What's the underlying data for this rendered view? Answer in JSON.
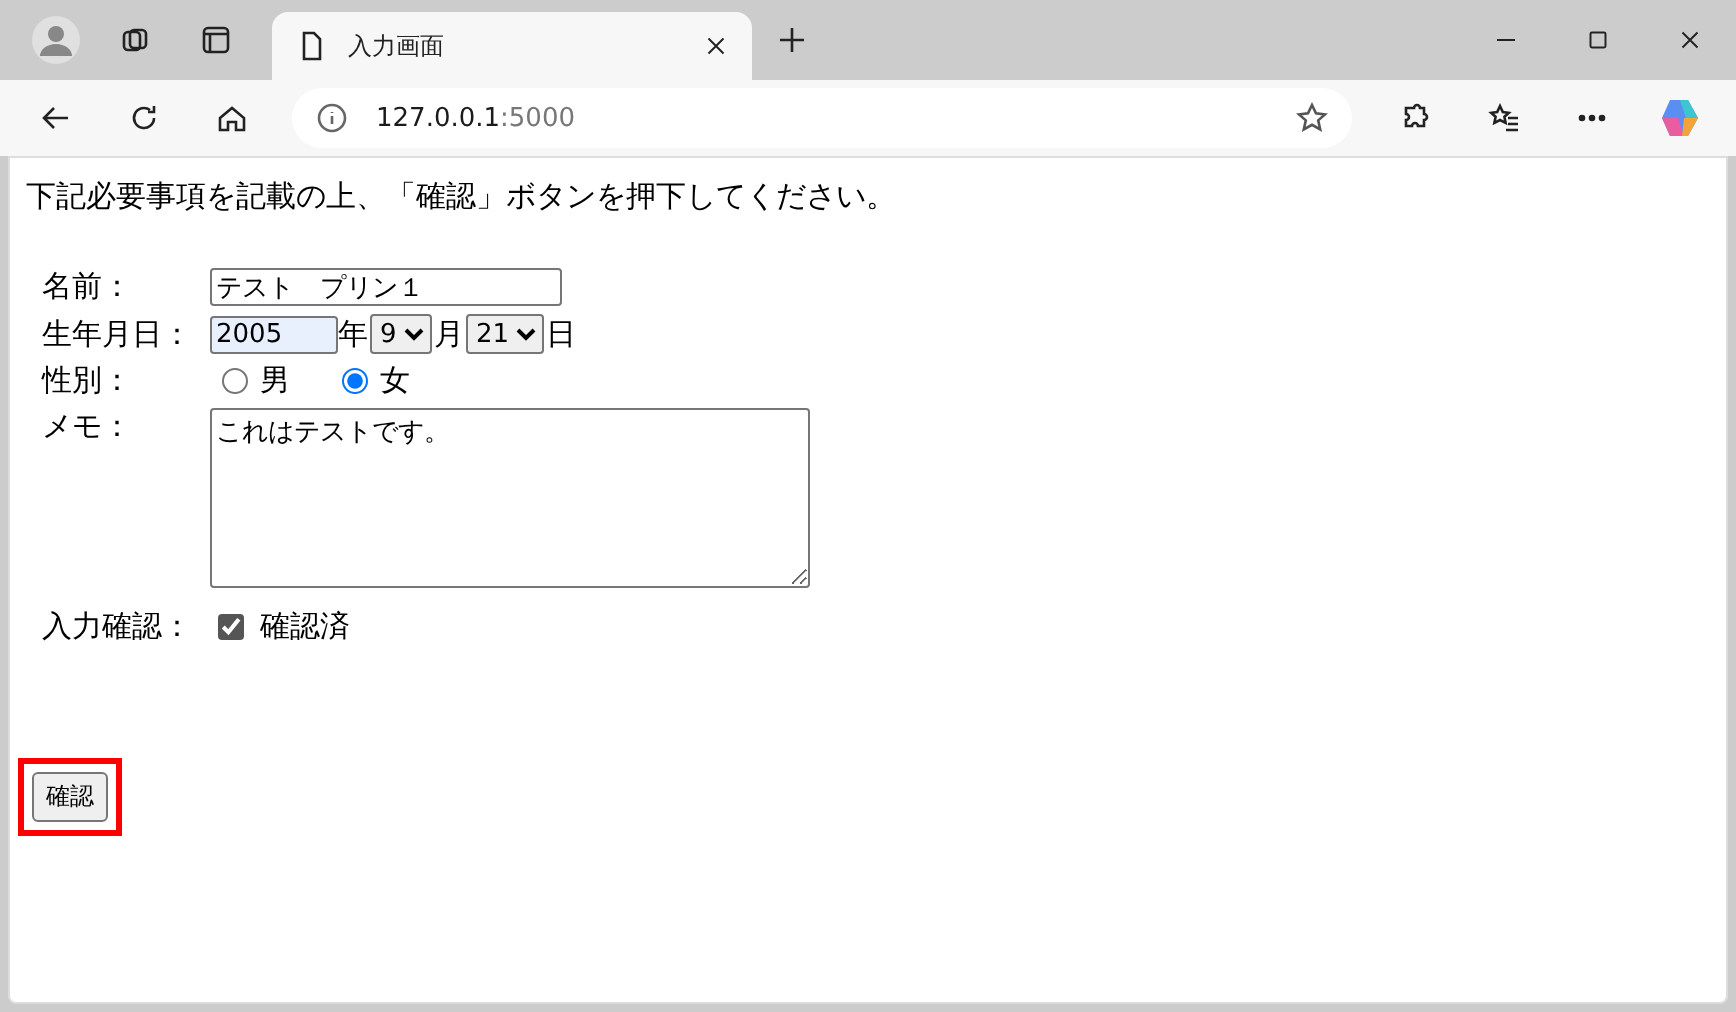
{
  "browser": {
    "tab": {
      "title": "入力画面",
      "selected": true
    },
    "address": {
      "host": "127.0.0.1",
      "port": ":5000"
    }
  },
  "page": {
    "instruction": "下記必要事項を記載の上、「確認」ボタンを押下してください。",
    "name": {
      "label": "名前：",
      "value": "テスト　プリン１"
    },
    "birth": {
      "label": "生年月日：",
      "year": "2005",
      "year_autofilled": true,
      "year_unit": "年",
      "month": "9",
      "month_unit": "月",
      "day": "21",
      "day_unit": "日"
    },
    "gender": {
      "label": "性別：",
      "options": [
        {
          "label": "男",
          "selected": false
        },
        {
          "label": "女",
          "selected": true
        }
      ]
    },
    "memo": {
      "label": "メモ：",
      "value": "これはテストです。"
    },
    "confirm": {
      "label": "入力確認：",
      "checkbox_label": "確認済",
      "checked": true
    },
    "submit": {
      "label": "確認",
      "highlighted": true
    }
  }
}
